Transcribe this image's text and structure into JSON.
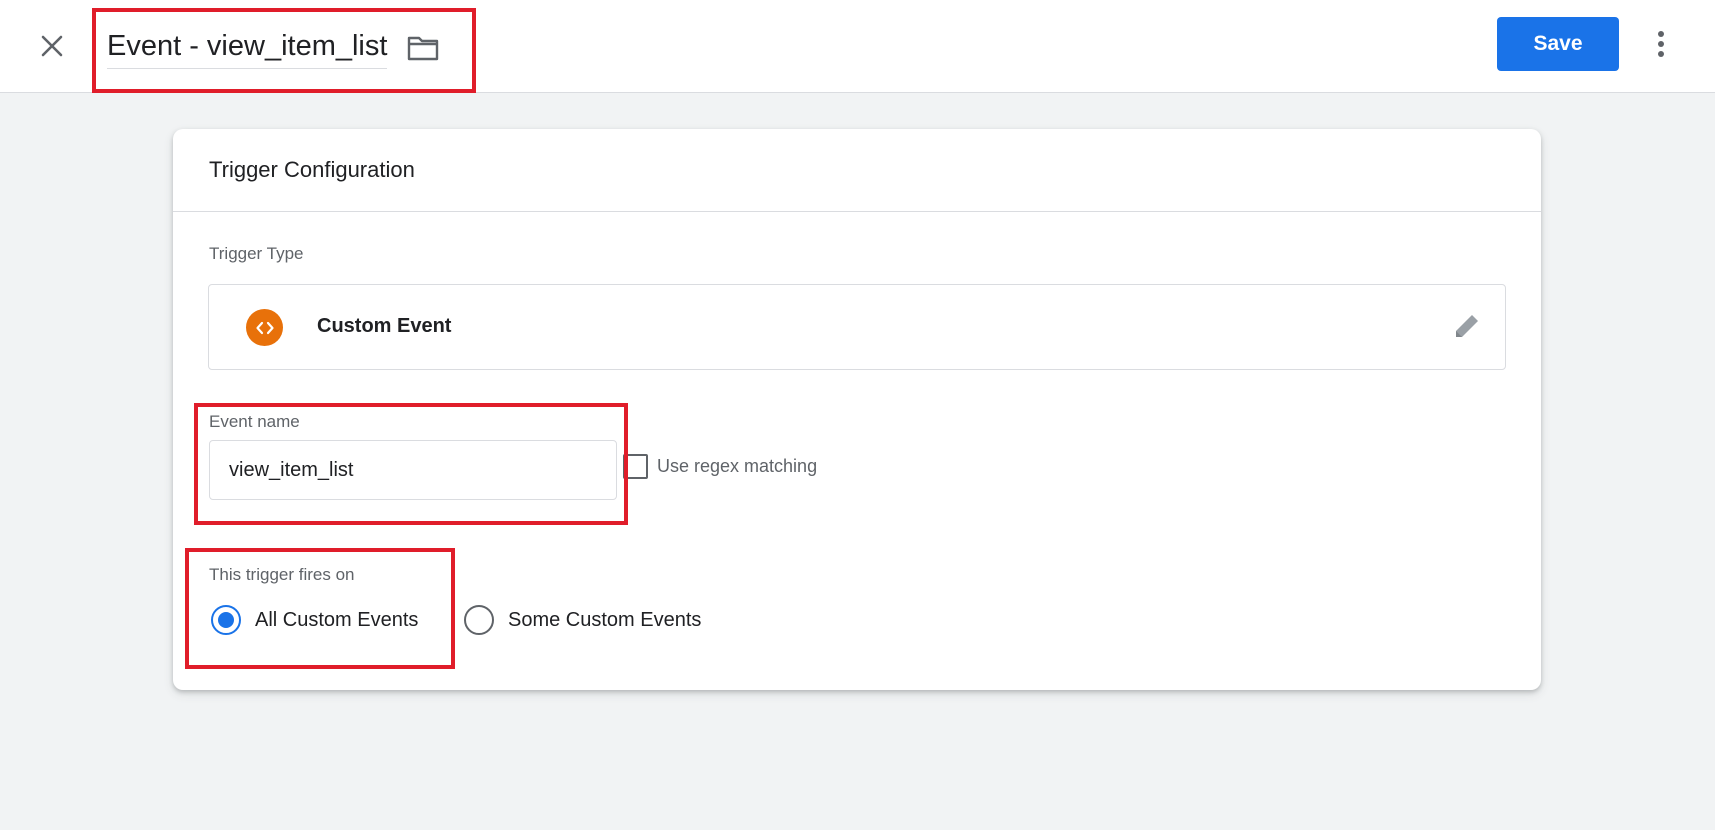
{
  "header": {
    "title": "Event - view_item_list",
    "save_label": "Save",
    "close_icon": "close-icon",
    "folder_icon": "folder-icon",
    "more_icon": "more-vert-icon"
  },
  "card": {
    "title": "Trigger Configuration",
    "trigger_type_label": "Trigger Type",
    "trigger_type_name": "Custom Event",
    "trigger_type_icon": "code-brackets-icon",
    "edit_icon": "pencil-icon",
    "event_name_label": "Event name",
    "event_name_value": "view_item_list",
    "regex_label": "Use regex matching",
    "regex_checked": false,
    "fires_on_label": "This trigger fires on",
    "fires_on_options": [
      {
        "label": "All Custom Events",
        "selected": true
      },
      {
        "label": "Some Custom Events",
        "selected": false
      }
    ]
  },
  "colors": {
    "accent": "#1a73e8",
    "trigger_icon": "#e8710a",
    "highlight": "#e01d2a",
    "page_bg": "#f1f3f4"
  }
}
